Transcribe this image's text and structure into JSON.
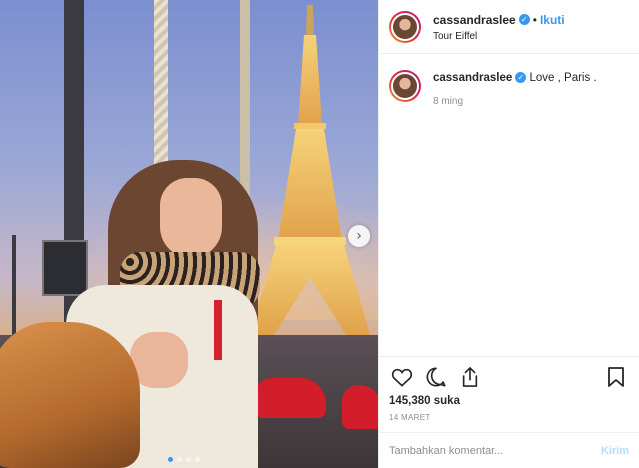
{
  "post": {
    "username": "cassandraslee",
    "verified_icon": "verified-badge-icon",
    "separator": "•",
    "follow_label": "Ikuti",
    "location": "Tour Eiffel",
    "caption": {
      "username": "cassandraslee",
      "text": "Love , Paris ."
    },
    "time_ago": "8 ming",
    "likes": "145,380 suka",
    "date": "14 MARET",
    "comment_placeholder": "Tambahkan komentar...",
    "post_label": "Kirim",
    "next_arrow": "›",
    "carousel": {
      "count": 4,
      "active": 1
    }
  },
  "icons": {
    "like": "heart-icon",
    "comment": "comment-icon",
    "share": "share-icon",
    "save": "bookmark-icon"
  },
  "colors": {
    "accent": "#3897f0",
    "muted": "#8e8e8e",
    "text": "#262626",
    "post_disabled": "#b2dffc"
  }
}
